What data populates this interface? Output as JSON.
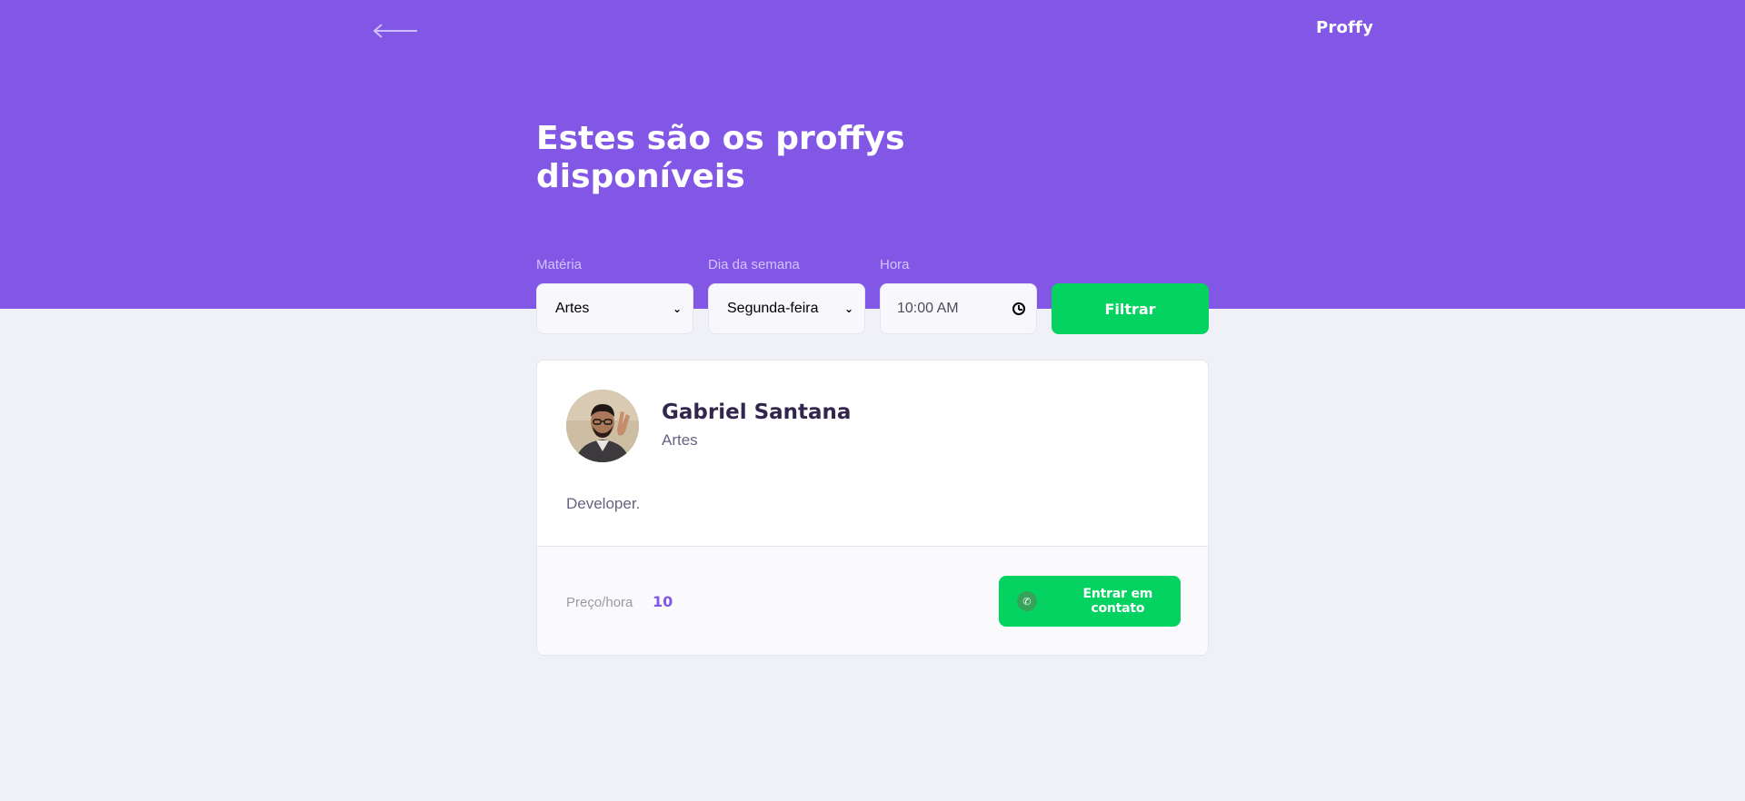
{
  "header": {
    "logo": "Proffy",
    "title": "Estes são os proffys disponíveis"
  },
  "filters": {
    "subject": {
      "label": "Matéria",
      "value": "Artes"
    },
    "weekday": {
      "label": "Dia da semana",
      "value": "Segunda-feira"
    },
    "time": {
      "label": "Hora",
      "value": "10:00 AM"
    },
    "submit_label": "Filtrar"
  },
  "teachers": [
    {
      "name": "Gabriel Santana",
      "subject": "Artes",
      "bio": "Developer.",
      "price_label": "Preço/hora",
      "price": "10",
      "contact_label": "Entrar em contato"
    }
  ],
  "colors": {
    "primary": "#8257e5",
    "secondary": "#04d361",
    "background": "#f0f0f7",
    "title_text": "#32264d",
    "body_text": "#6a6180"
  },
  "icons": {
    "back": "arrow-left-icon",
    "time": "clock-icon",
    "select": "chevron-down-icon",
    "contact": "whatsapp-icon"
  }
}
